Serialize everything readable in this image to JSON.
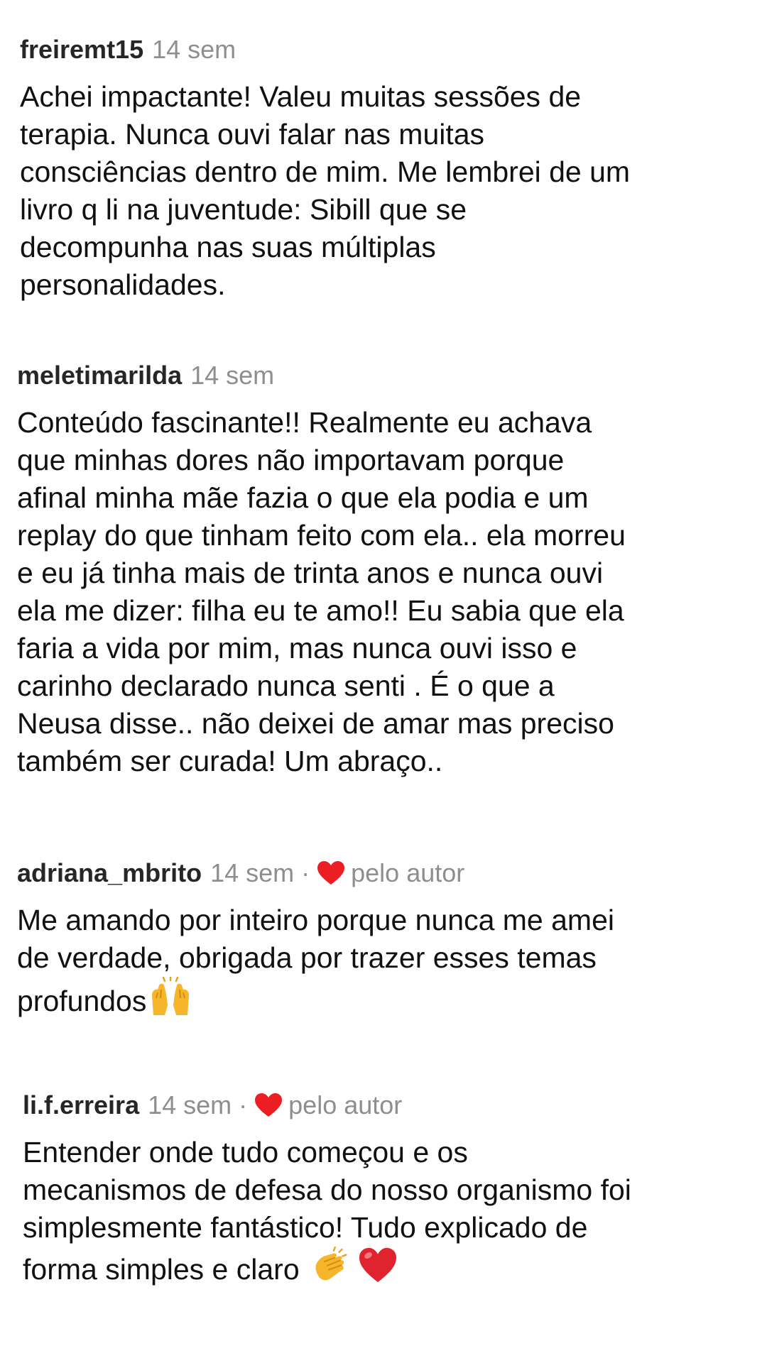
{
  "comments": [
    {
      "username": "freiremt15",
      "time": "14 sem",
      "liked_by_author": false,
      "text": "Achei impactante! Valeu muitas sessões de\nterapia. Nunca ouvi falar nas muitas\nconsciências dentro de mim. Me lembrei de um\nlivro q li na juventude: Sibill que se\ndecompunha nas suas múltiplas\npersonalidades."
    },
    {
      "username": "meletimarilda",
      "time": "14 sem",
      "liked_by_author": false,
      "text": "Conteúdo fascinante!! Realmente eu achava\nque minhas dores não importavam porque\nafinal minha mãe fazia o que ela podia e um\nreplay do que tinham feito com ela.. ela morreu\ne eu já tinha mais de trinta anos e nunca ouvi\nela me dizer: filha eu te amo!! Eu sabia que ela\nfaria a vida por mim, mas nunca ouvi isso e\ncarinho declarado nunca senti . É o que a\nNeusa disse.. não deixei de amar mas preciso\ntambém ser curada! Um abraço.."
    },
    {
      "username": "adriana_mbrito",
      "time": "14 sem",
      "separator": "·",
      "liked_by_author": true,
      "liked_label": "pelo autor",
      "text": "Me amando por inteiro porque nunca me amei\nde verdade,  obrigada por trazer esses temas\nprofundos",
      "emojis": [
        "raising-hands-emoji"
      ]
    },
    {
      "username": "li.f.erreira",
      "time": "14 sem",
      "separator": "·",
      "liked_by_author": true,
      "liked_label": "pelo autor",
      "text": "Entender onde tudo começou e os\nmecanismos de defesa do nosso organismo foi\nsimplesmente fantástico! Tudo explicado de\nforma simples e claro ",
      "emojis": [
        "clapping-hands-emoji",
        "red-heart-emoji"
      ]
    }
  ],
  "colors": {
    "heart": "#ed1d24",
    "meta_gray": "#8e8e8e",
    "username": "#262626",
    "emoji_yellow": "#f6b52a"
  }
}
